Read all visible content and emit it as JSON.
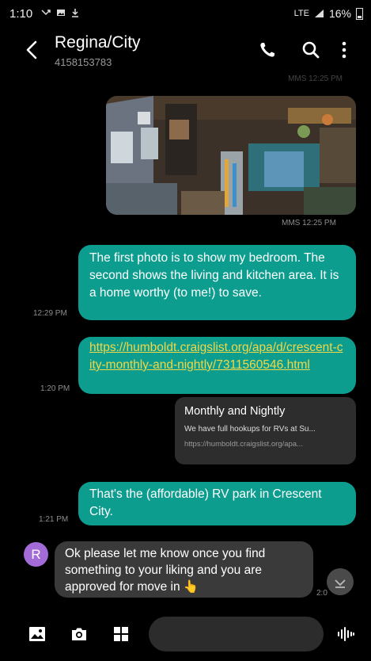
{
  "status_bar": {
    "time": "1:10",
    "network": "LTE",
    "battery": "16%"
  },
  "header": {
    "contact_name": "Regina/City",
    "phone_number": "4158153783"
  },
  "messages": {
    "faded_top_meta": "MMS 12:25 PM",
    "photo_meta": "MMS 12:25 PM",
    "msg1": {
      "text": "The first photo is to show my bedroom. The second shows the living and kitchen area.  It is a home worthy (to me!) to save.",
      "time": "12:29 PM"
    },
    "msg2": {
      "link": "https://humboldt.craigslist.org/apa/d/crescent-city-monthly-and-nightly/7311560546.html",
      "time": "1:20 PM"
    },
    "link_preview": {
      "title": "Monthly and Nightly",
      "description": "We have full hookups for RVs at Su...",
      "url": "https://humboldt.craigslist.org/apa..."
    },
    "msg3": {
      "text": "That's the (affordable) RV park in Crescent City.",
      "time": "1:21 PM"
    },
    "incoming": {
      "avatar_letter": "R",
      "text": "Ok please let me know once you find something to your liking and you are approved for move in 👆",
      "time": "2:0"
    }
  },
  "colors": {
    "outgoing_bubble": "#0d9d8f",
    "incoming_bubble": "#3a3a3a",
    "link": "#f0d848",
    "avatar": "#a36bd8"
  }
}
